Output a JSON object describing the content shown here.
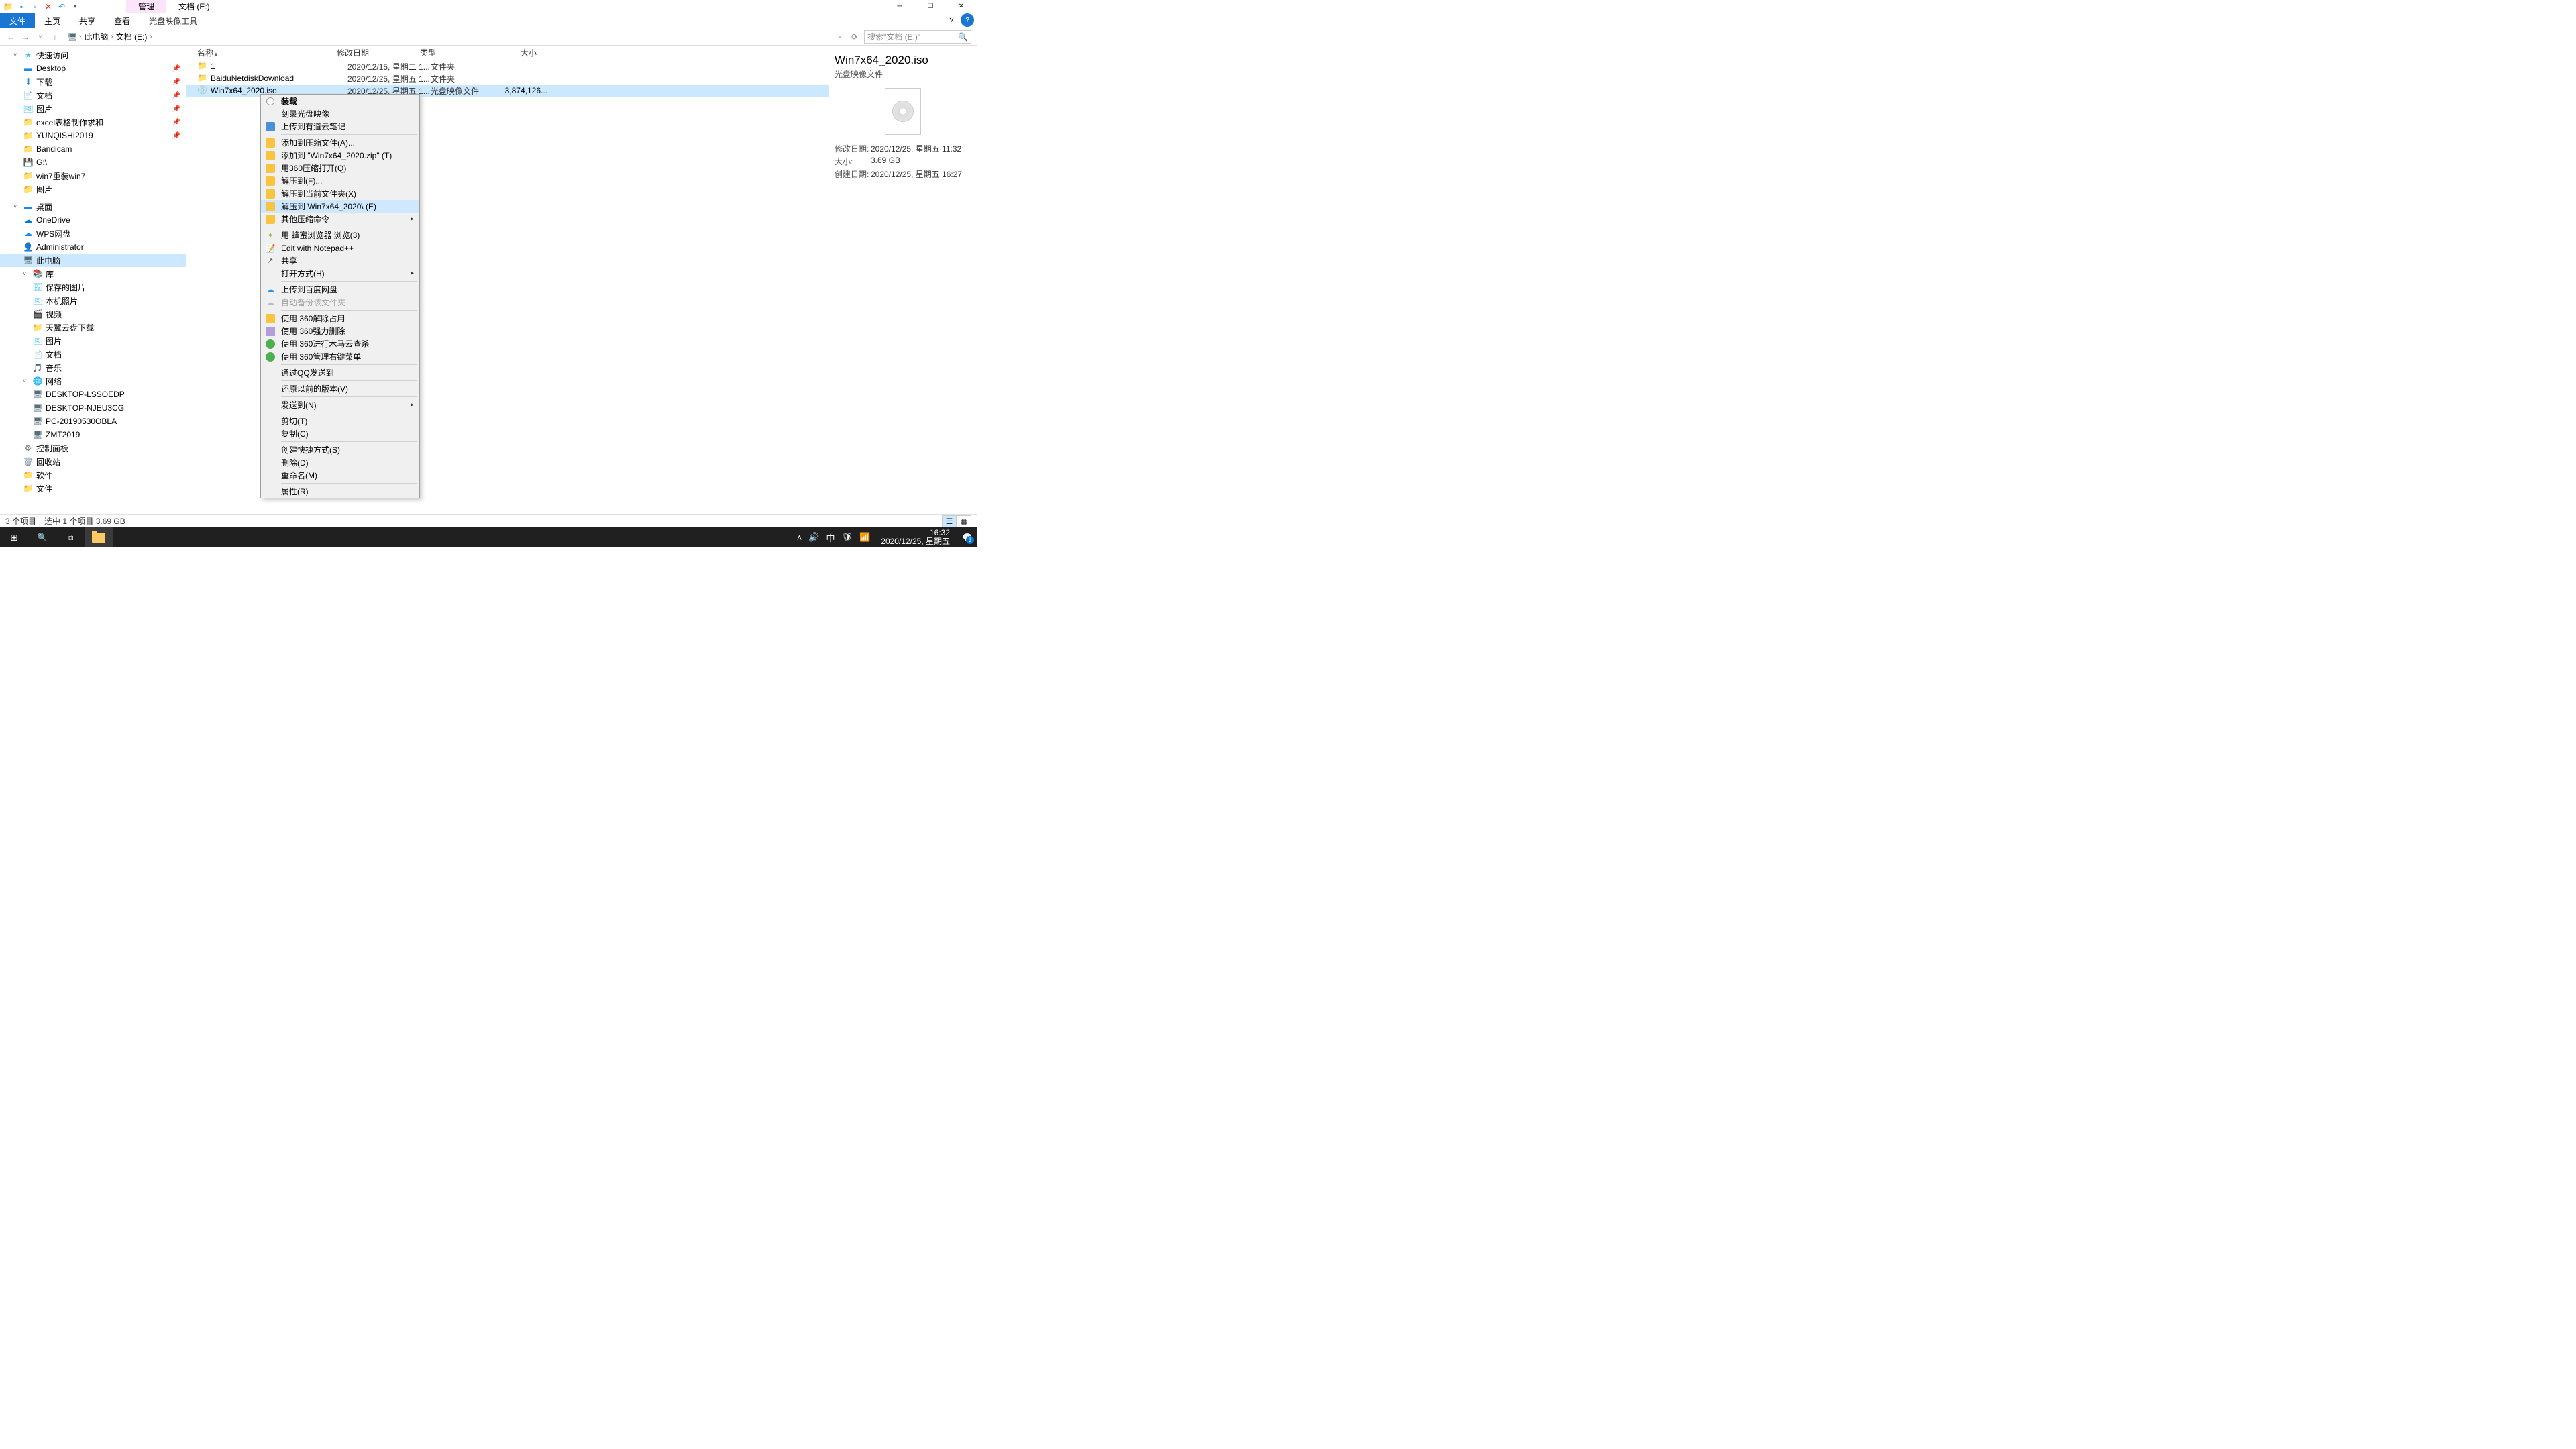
{
  "title_tabs": {
    "manage": "管理",
    "location": "文档 (E:)"
  },
  "ribbon": {
    "file": "文件",
    "home": "主页",
    "share": "共享",
    "view": "查看",
    "iso_tools": "光盘映像工具"
  },
  "breadcrumb": {
    "pc": "此电脑",
    "drive": "文档 (E:)"
  },
  "search": {
    "placeholder": "搜索\"文档 (E:)\""
  },
  "tree": {
    "quick": "快速访问",
    "desktop": "Desktop",
    "downloads": "下载",
    "documents": "文档",
    "pictures": "图片",
    "excel": "excel表格制作求和",
    "yunqishi": "YUNQISHI2019",
    "bandicam": "Bandicam",
    "gdrive": "G:\\",
    "win7": "win7重装win7",
    "pictures2": "图片",
    "desktop2": "桌面",
    "onedrive": "OneDrive",
    "wps": "WPS网盘",
    "admin": "Administrator",
    "thispc": "此电脑",
    "libraries": "库",
    "saved_pics": "保存的图片",
    "local_photos": "本机照片",
    "videos": "视频",
    "tianyi": "天翼云盘下载",
    "pictures3": "图片",
    "docs2": "文档",
    "music": "音乐",
    "network": "网络",
    "net_lsso": "DESKTOP-LSSOEDP",
    "net_njeu": "DESKTOP-NJEU3CG",
    "net_pc2019": "PC-20190530OBLA",
    "net_zmt": "ZMT2019",
    "control_panel": "控制面板",
    "recycle": "回收站",
    "software": "软件",
    "files": "文件"
  },
  "columns": {
    "name": "名称",
    "date": "修改日期",
    "type": "类型",
    "size": "大小"
  },
  "rows": [
    {
      "name": "1",
      "date": "2020/12/15, 星期二 1...",
      "type": "文件夹",
      "size": ""
    },
    {
      "name": "BaiduNetdiskDownload",
      "date": "2020/12/25, 星期五 1...",
      "type": "文件夹",
      "size": ""
    },
    {
      "name": "Win7x64_2020.iso",
      "date": "2020/12/25, 星期五 1...",
      "type": "光盘映像文件",
      "size": "3,874,126..."
    }
  ],
  "context_menu": {
    "mount": "装载",
    "burn": "刻录光盘映像",
    "youdao": "上传到有道云笔记",
    "add_archive": "添加到压缩文件(A)...",
    "add_zip": "添加到 \"Win7x64_2020.zip\" (T)",
    "open_360": "用360压缩打开(Q)",
    "extract_to": "解压到(F)...",
    "extract_here": "解压到当前文件夹(X)",
    "extract_named": "解压到 Win7x64_2020\\ (E)",
    "other_zip": "其他压缩命令",
    "bee_browser": "用 蜂蜜浏览器 浏览(3)",
    "notepad": "Edit with Notepad++",
    "share": "共享",
    "open_with": "打开方式(H)",
    "baidu_upload": "上传到百度网盘",
    "auto_backup": "自动备份该文件夹",
    "unlock_360": "使用 360解除占用",
    "force_del": "使用 360强力删除",
    "trojan": "使用 360进行木马云查杀",
    "manage_menu": "使用 360管理右键菜单",
    "qq_send": "通过QQ发送到",
    "restore": "还原以前的版本(V)",
    "send_to": "发送到(N)",
    "cut": "剪切(T)",
    "copy": "复制(C)",
    "shortcut": "创建快捷方式(S)",
    "delete": "删除(D)",
    "rename": "重命名(M)",
    "properties": "属性(R)"
  },
  "details": {
    "title": "Win7x64_2020.iso",
    "subtitle": "光盘映像文件",
    "mod_label": "修改日期:",
    "mod_val": "2020/12/25, 星期五 11:32",
    "size_label": "大小:",
    "size_val": "3.69 GB",
    "create_label": "创建日期:",
    "create_val": "2020/12/25, 星期五 16:27"
  },
  "status": {
    "count": "3 个项目",
    "selected": "选中 1 个项目  3.69 GB"
  },
  "taskbar": {
    "ime": "中",
    "time": "16:32",
    "date": "2020/12/25, 星期五",
    "notif_count": "3"
  }
}
